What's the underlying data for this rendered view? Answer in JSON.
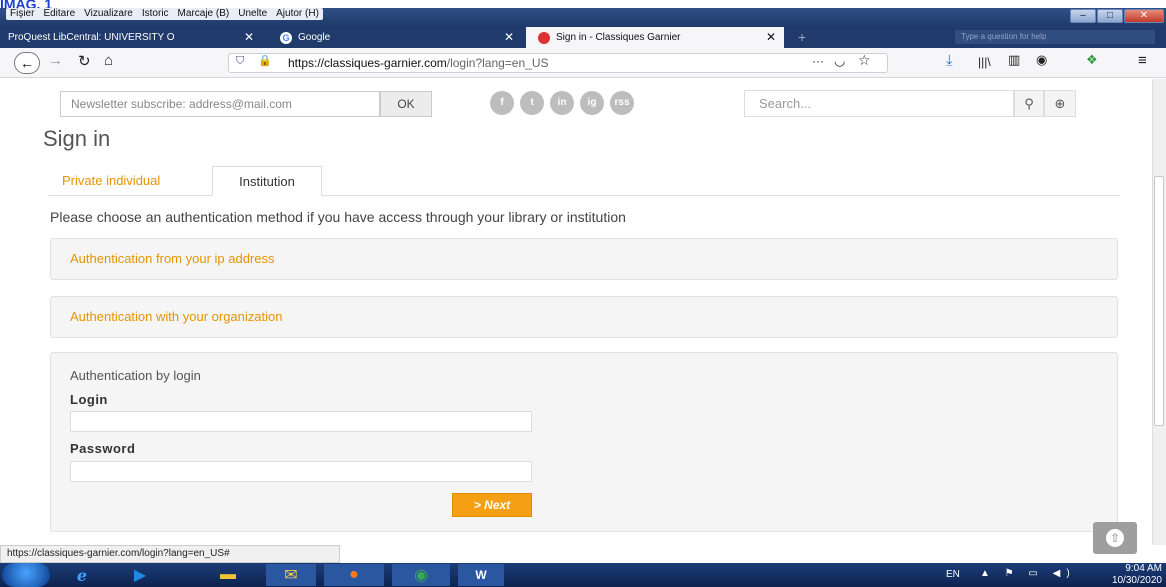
{
  "overlay_label": "IMAG. 1",
  "menu": [
    "Fişier",
    "Editare",
    "Vizualizare",
    "Istoric",
    "Marcaje (B)",
    "Unelte",
    "Ajutor (H)"
  ],
  "tabs": [
    {
      "title": "ProQuest LibCentral: UNIVERSITY O"
    },
    {
      "title": "Google"
    },
    {
      "title": "Sign in - Classiques Garnier"
    }
  ],
  "tab_search_hint": "Type a question for help",
  "url": {
    "domain": "https://classiques-garnier.com",
    "path": "/login?lang=en_US"
  },
  "header": {
    "newsletter_placeholder": "Newsletter subscribe: address@mail.com",
    "ok_label": "OK",
    "social": [
      "f",
      "t",
      "in",
      "ig",
      "rss"
    ],
    "search_placeholder": "Search..."
  },
  "page_title": "Sign in",
  "tabs_page": {
    "private": "Private individual",
    "institution": "Institution"
  },
  "instructions": "Please choose an authentication method if you have access through your library or institution",
  "panels": {
    "ip": "Authentication from your ip address",
    "org": "Authentication with your organization",
    "login_heading": "Authentication by login",
    "login_label": "Login",
    "password_label": "Password",
    "next_label": "> Next"
  },
  "status_url": "https://classiques-garnier.com/login?lang=en_US#",
  "taskbar": {
    "lang": "EN",
    "time": "9:04 AM",
    "date": "10/30/2020"
  },
  "colors": {
    "accent": "#f5a014",
    "link": "#e59400",
    "title_bar": "#1f3a6b",
    "taskbar": "#1c3d78"
  }
}
